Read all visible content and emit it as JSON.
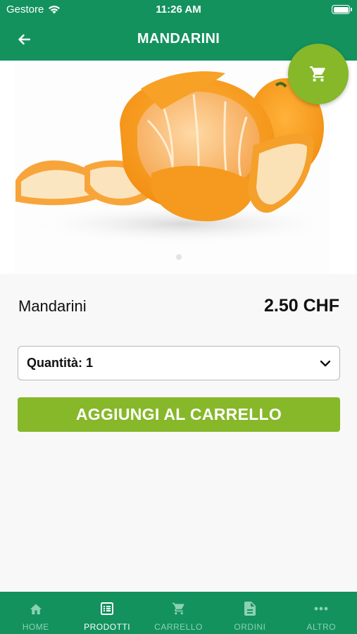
{
  "status_bar": {
    "carrier": "Gestore",
    "time": "11:26 AM"
  },
  "header": {
    "title": "MANDARINI"
  },
  "product": {
    "name": "Mandarini",
    "price": "2.50 CHF"
  },
  "quantity": {
    "label": "Quantità: 1"
  },
  "add_button": {
    "label": "AGGIUNGI AL CARRELLO"
  },
  "tabs": [
    {
      "label": "HOME",
      "icon": "home-icon",
      "active": false
    },
    {
      "label": "PRODOTTI",
      "icon": "list-icon",
      "active": true
    },
    {
      "label": "CARRELLO",
      "icon": "cart-icon",
      "active": false
    },
    {
      "label": "ORDINI",
      "icon": "document-icon",
      "active": false
    },
    {
      "label": "ALTRO",
      "icon": "more-icon",
      "active": false
    }
  ],
  "colors": {
    "primary": "#13925e",
    "accent": "#86b82a",
    "tab_inactive": "#8cd2b2"
  }
}
